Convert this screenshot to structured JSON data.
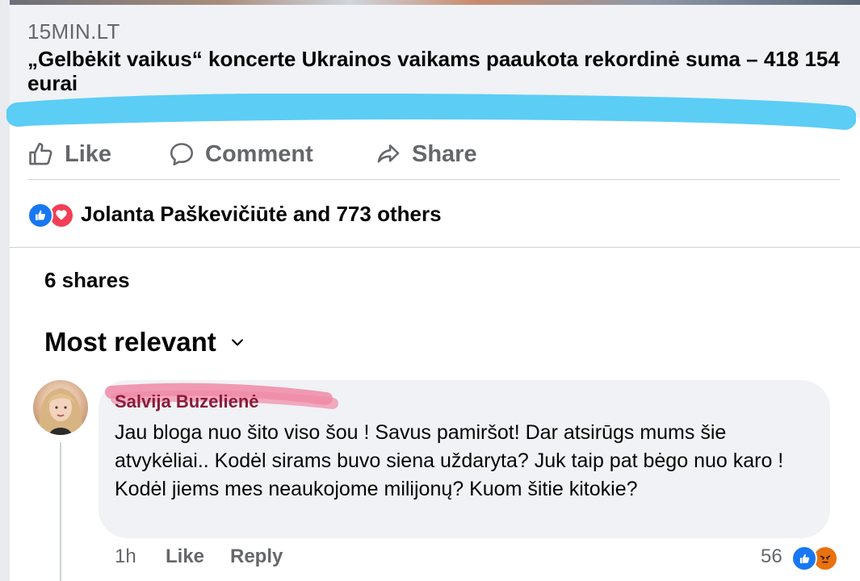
{
  "link_preview": {
    "domain": "15MIN.LT",
    "headline": "„Gelbėkit vaikus“ koncerte Ukrainos vaikams paaukota rekordinė suma – 418 154 eurai"
  },
  "actions": {
    "like_label": "Like",
    "comment_label": "Comment",
    "share_label": "Share"
  },
  "reactions": {
    "summary": "Jolanta Paškevičiūtė and 773 others",
    "icons": [
      "like-icon",
      "love-icon"
    ]
  },
  "shares": "6 shares",
  "sort": {
    "label": "Most relevant"
  },
  "comment": {
    "author": "Salvija Buzelienė",
    "text": "Jau bloga nuo šito viso šou ! Savus pamiršot! Dar atsirūgs mums šie atvykėliai.. Kodėl sirams buvo siena uždaryta? Juk taip pat bėgo nuo karo ! Kodėl jiems mes neaukojome milijonų? Kuom šitie kitokie?",
    "time": "1h",
    "like_label": "Like",
    "reply_label": "Reply",
    "reaction_count": "56",
    "reaction_icons": [
      "like-icon",
      "angry-icon"
    ]
  },
  "colors": {
    "marker_blue": "#5ccdf5",
    "marker_pink": "#f08aa6",
    "fb_blue": "#1877f2",
    "love_red": "#f33e58",
    "angry_orange": "#e9710f"
  }
}
